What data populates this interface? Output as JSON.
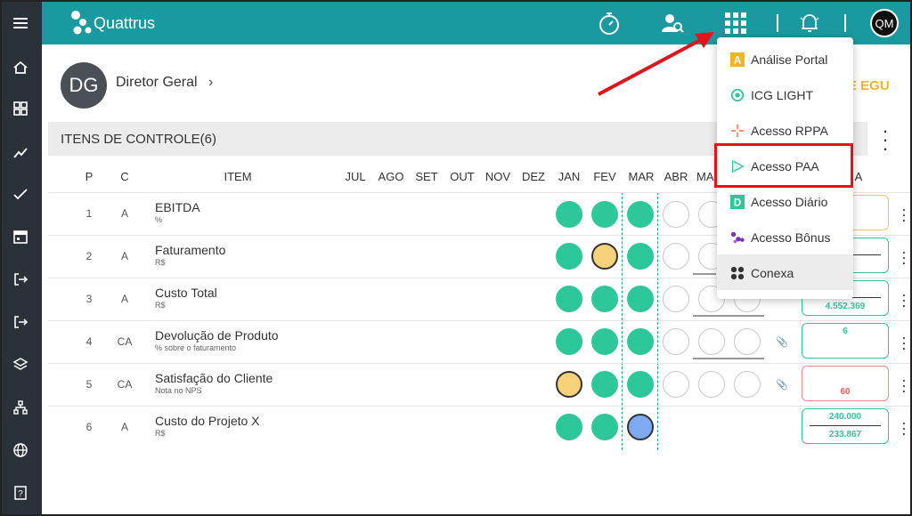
{
  "app": {
    "name": "Quattrus",
    "avatar_initials": "QM"
  },
  "sidebar": {
    "items": [
      {
        "icon": "menu-icon"
      },
      {
        "icon": "home-icon"
      },
      {
        "icon": "dashboard-icon"
      },
      {
        "icon": "trend-icon"
      },
      {
        "icon": "check-icon"
      },
      {
        "icon": "calendar-icon"
      },
      {
        "icon": "exit-icon"
      },
      {
        "icon": "exit-icon"
      },
      {
        "icon": "layers-icon"
      },
      {
        "icon": "hierarchy-icon"
      },
      {
        "icon": "globe-icon"
      },
      {
        "icon": "help-icon"
      }
    ]
  },
  "header": {
    "initials": "DG",
    "name": "Diretor Geral",
    "chevron": "›",
    "right_title": "E EGU"
  },
  "section": {
    "title": "ITENS DE CONTROLE(6)"
  },
  "table": {
    "headers": {
      "p": "P",
      "c": "C",
      "item": "ITEM",
      "months": [
        "JUL",
        "AGO",
        "SET",
        "OUT",
        "NOV",
        "DEZ",
        "JAN",
        "FEV",
        "MAR",
        "ABR",
        "MA"
      ],
      "extra": "A"
    },
    "rows": [
      {
        "p": "1",
        "c": "A",
        "item": "EBITDA",
        "unit": "%",
        "status": [
          "green",
          "green",
          "green"
        ],
        "box_top": "",
        "box_bottom": ""
      },
      {
        "p": "2",
        "c": "A",
        "item": "Faturamento",
        "unit": "R$",
        "status": [
          "green",
          "yellow",
          "green"
        ],
        "box_top": "000",
        "box_bottom": "053"
      },
      {
        "p": "3",
        "c": "A",
        "item": "Custo Total",
        "unit": "R$",
        "status": [
          "green",
          "green",
          "green"
        ],
        "box_top": "000",
        "box_bottom": "4.552.369"
      },
      {
        "p": "4",
        "c": "CA",
        "item": "Devolução de Produto",
        "unit": "% sobre o faturamento",
        "status": [
          "green",
          "green",
          "green"
        ],
        "box_top": "6",
        "box_bottom": ""
      },
      {
        "p": "5",
        "c": "CA",
        "item": "Satisfação do Cliente",
        "unit": "Nota no NPS",
        "status": [
          "yellow",
          "green",
          "green"
        ],
        "box_top": "",
        "box_bottom": "60"
      },
      {
        "p": "6",
        "c": "A",
        "item": "Custo do Projeto X",
        "unit": "R$",
        "status": [
          "green",
          "green",
          "blue"
        ],
        "box_top": "240.000",
        "box_bottom": "233.867"
      }
    ]
  },
  "menu": {
    "items": [
      {
        "label": "Análise Portal",
        "icon": "portal-a-icon",
        "color": "#f0b429"
      },
      {
        "label": "ICG LIGHT",
        "icon": "icg-light-icon",
        "color": "#2ec79a"
      },
      {
        "label": "Acesso RPPA",
        "icon": "rppa-icon",
        "color": "#f08a5d"
      },
      {
        "label": "Acesso PAA",
        "icon": "paa-play-icon",
        "color": "#2ec79a"
      },
      {
        "label": "Acesso Diário",
        "icon": "diario-d-icon",
        "color": "#2ec79a"
      },
      {
        "label": "Acesso Bônus",
        "icon": "bonus-dots-icon",
        "color": "#7b2fbe"
      },
      {
        "label": "Conexa",
        "icon": "conexa-icon",
        "color": "#333333"
      }
    ]
  },
  "colors": {
    "teal": "#1a9aa0",
    "sidebar": "#2b3138",
    "green": "#2ec79a",
    "yellow": "#f5d27a",
    "blue": "#7eaaf1",
    "highlight": "#e0141a"
  }
}
